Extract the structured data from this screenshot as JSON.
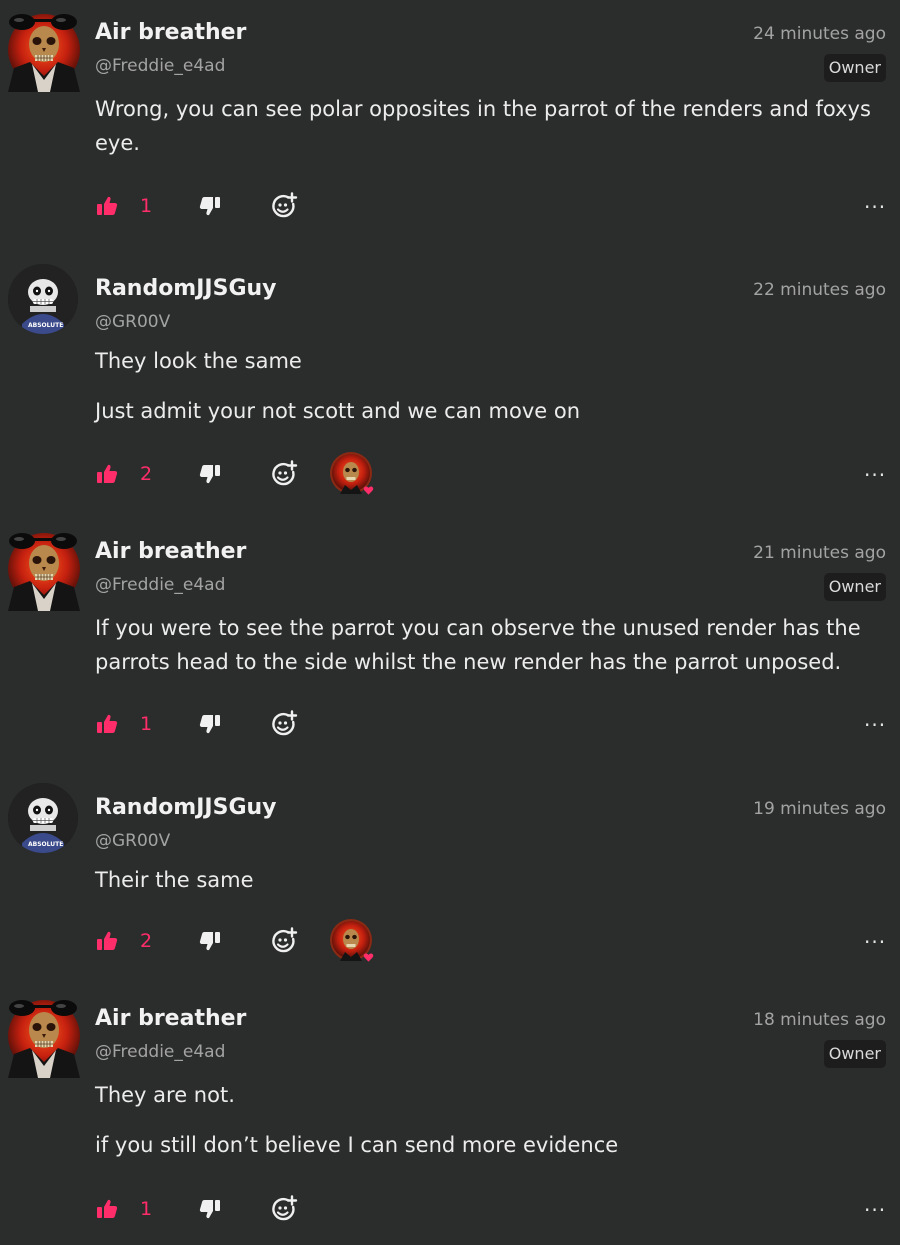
{
  "colors": {
    "background": "#2b2d2c",
    "accent_pink": "#ff2d6a",
    "muted_text": "#a3a3a3",
    "badge_bg": "#1c1d1c"
  },
  "icons": {
    "like": "thumbs-up-icon",
    "dislike": "thumbs-down-icon",
    "react": "add-reaction-icon",
    "more": "more-options-icon"
  },
  "comments": [
    {
      "username": "Air breather",
      "handle": "@Freddie_e4ad",
      "time": "24 minutes ago",
      "badge": "Owner",
      "paragraphs": [
        "Wrong, you can see polar opposites in the parrot of the renders and foxys eye."
      ],
      "likes": "1",
      "more": "..."
    },
    {
      "username": "RandomJJSGuy",
      "handle": "@GR00V",
      "time": "22 minutes ago",
      "avatar_caption": "ABSOLUTE",
      "paragraphs": [
        "They look the same",
        "Just admit your not scott and we can move on"
      ],
      "likes": "2",
      "more": "..."
    },
    {
      "username": "Air breather",
      "handle": "@Freddie_e4ad",
      "time": "21 minutes ago",
      "badge": "Owner",
      "paragraphs": [
        "If you were to see the parrot you can observe the unused render has the parrots head to the side whilst the new render has the parrot unposed."
      ],
      "likes": "1",
      "more": "..."
    },
    {
      "username": "RandomJJSGuy",
      "handle": "@GR00V",
      "time": "19 minutes ago",
      "avatar_caption": "ABSOLUTE",
      "paragraphs": [
        "Their the same"
      ],
      "likes": "2",
      "more": "..."
    },
    {
      "username": "Air breather",
      "handle": "@Freddie_e4ad",
      "time": "18 minutes ago",
      "badge": "Owner",
      "paragraphs": [
        "They are not.",
        "if you still don’t believe I can send more evidence"
      ],
      "likes": "1",
      "more": "..."
    }
  ]
}
